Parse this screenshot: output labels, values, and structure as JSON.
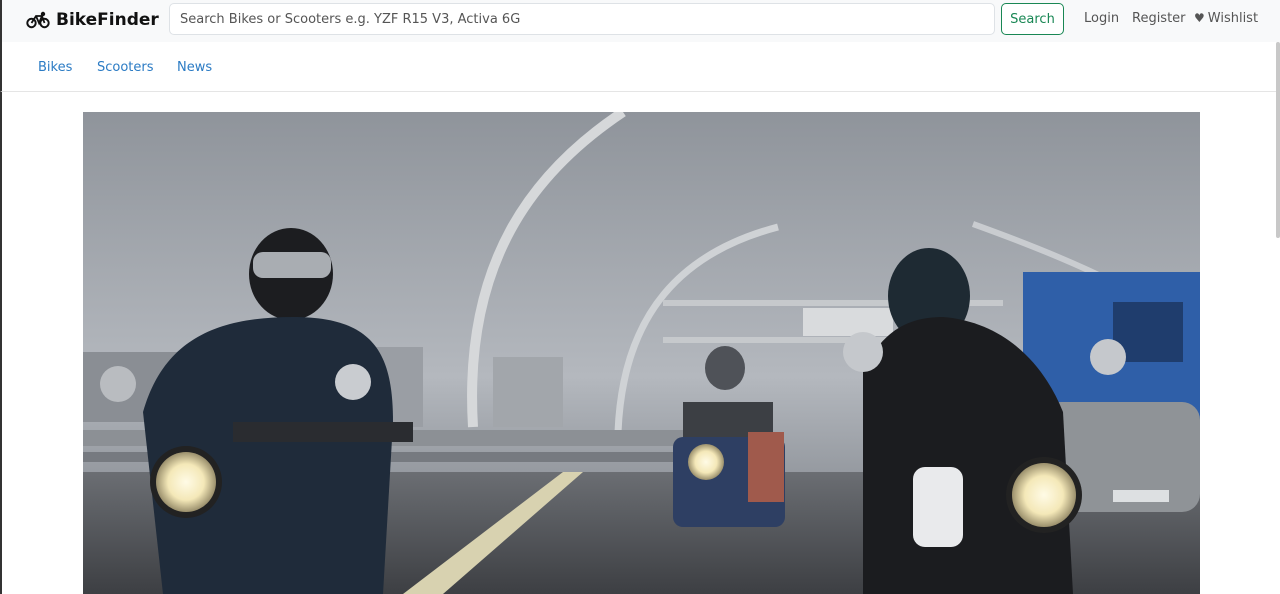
{
  "brand": {
    "name": "BikeFinder",
    "icon": "bike-icon"
  },
  "search": {
    "placeholder": "Search Bikes or Scooters e.g. YZF R15 V3, Activa 6G",
    "value": "",
    "button_label": "Search"
  },
  "auth": {
    "login": "Login",
    "register": "Register"
  },
  "wishlist": {
    "label": "Wishlist",
    "icon": "heart-icon"
  },
  "nav": {
    "items": [
      {
        "label": "Bikes"
      },
      {
        "label": "Scooters"
      },
      {
        "label": "News"
      }
    ]
  },
  "hero": {
    "alt": ""
  },
  "colors": {
    "accent": "#198754",
    "link": "#2b7bc4",
    "navbar_bg": "#f8f9fa"
  }
}
